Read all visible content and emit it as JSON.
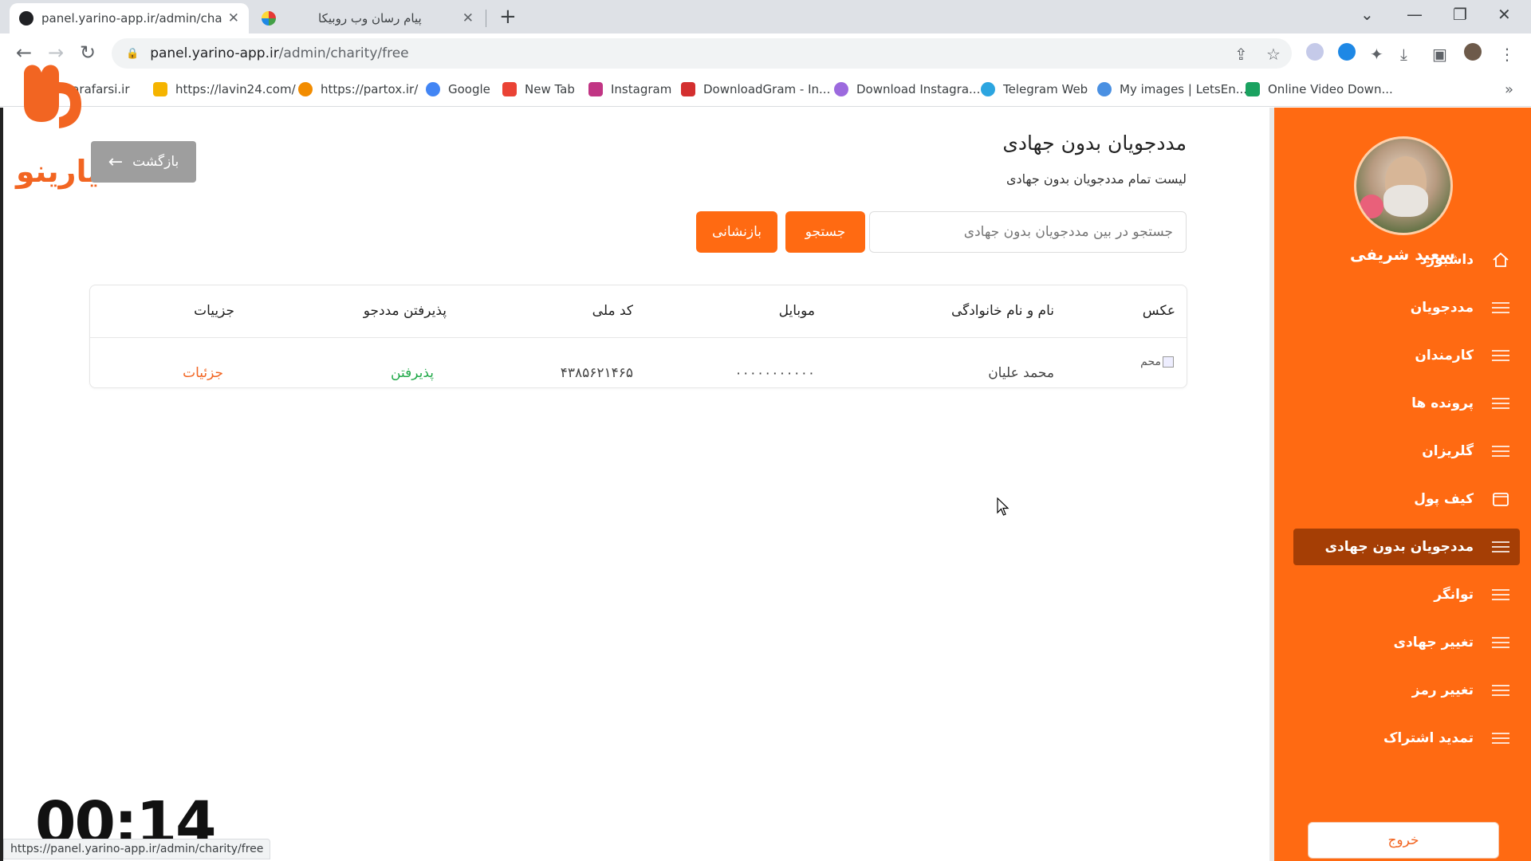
{
  "browser": {
    "tabs": [
      {
        "title": "panel.yarino-app.ir/admin/charit",
        "active": true
      },
      {
        "title": "پیام رسان وب روبیکا",
        "active": false
      }
    ],
    "url_host": "panel.yarino-app.ir",
    "url_path": "/admin/charity/free",
    "bookmarks": [
      {
        "label": "w...esarafarsi.ir",
        "icon": "bookmark-icon",
        "color": "#4a4a4a"
      },
      {
        "label": "https://lavin24.com/",
        "icon": "lavin-icon",
        "color": "#f5b400"
      },
      {
        "label": "https://partox.ir/",
        "icon": "partox-icon",
        "color": "#f28c00"
      },
      {
        "label": "Google",
        "icon": "google-icon",
        "color": "#4285f4"
      },
      {
        "label": "New Tab",
        "icon": "gmail-icon",
        "color": "#ea4335"
      },
      {
        "label": "Instagram",
        "icon": "instagram-icon",
        "color": "#c13584"
      },
      {
        "label": "DownloadGram - In...",
        "icon": "downloadgram-icon",
        "color": "#d32f2f"
      },
      {
        "label": "Download Instagra...",
        "icon": "download-instagram-icon",
        "color": "#9c6ade"
      },
      {
        "label": "Telegram Web",
        "icon": "telegram-icon",
        "color": "#2ca5e0"
      },
      {
        "label": "My images | LetsEn...",
        "icon": "letsenhance-icon",
        "color": "#4a90e2"
      },
      {
        "label": "Online Video Down...",
        "icon": "video-download-icon",
        "color": "#1aa260"
      }
    ],
    "status_url": "https://panel.yarino-app.ir/admin/charity/free"
  },
  "brand": {
    "logo_text": "یارینو",
    "color": "#f26522"
  },
  "header": {
    "back_label": "بازگشت",
    "title": "مددجویان بدون جهادی",
    "subtitle": "لیست تمام مددجویان بدون جهادی"
  },
  "search": {
    "placeholder": "جستجو در بین مددجویان بدون جهادی",
    "search_label": "جستجو",
    "reset_label": "بازنشانی"
  },
  "table": {
    "columns": [
      "عکس",
      "نام و نام خانوادگی",
      "موبایل",
      "کد ملی",
      "پذیرفتن مددجو",
      "جزییات"
    ],
    "rows": [
      {
        "photo_alt": "محم",
        "name": "محمد علیان",
        "mobile": "۰۰۰۰۰۰۰۰۰۰۰",
        "national_code": "۴۳۸۵۶۲۱۴۶۵",
        "accept": "پذیرفتن",
        "details": "جزئیات"
      }
    ]
  },
  "sidebar": {
    "user_name": "سعید شریفی",
    "items": [
      {
        "label": "داشبورد",
        "icon": "home-icon"
      },
      {
        "label": "مددجویان",
        "icon": "menu-icon"
      },
      {
        "label": "کارمندان",
        "icon": "menu-icon"
      },
      {
        "label": "پرونده ها",
        "icon": "menu-icon"
      },
      {
        "label": "گلریزان",
        "icon": "menu-icon"
      },
      {
        "label": "کیف پول",
        "icon": "wallet-icon"
      },
      {
        "label": "مددجویان بدون جهادی",
        "icon": "menu-icon",
        "active": true
      },
      {
        "label": "توانگر",
        "icon": "menu-icon"
      },
      {
        "label": "تغییر جهادی",
        "icon": "menu-icon"
      },
      {
        "label": "تغییر رمز",
        "icon": "menu-icon"
      },
      {
        "label": "تمدید اشتراک",
        "icon": "menu-icon"
      }
    ],
    "logout_label": "خروج"
  },
  "overlay": {
    "timer": "00:14"
  },
  "colors": {
    "accent": "#ff6a12",
    "active_nav": "#a53e05",
    "accept": "#22a94a",
    "back_button": "#9e9e9e"
  }
}
